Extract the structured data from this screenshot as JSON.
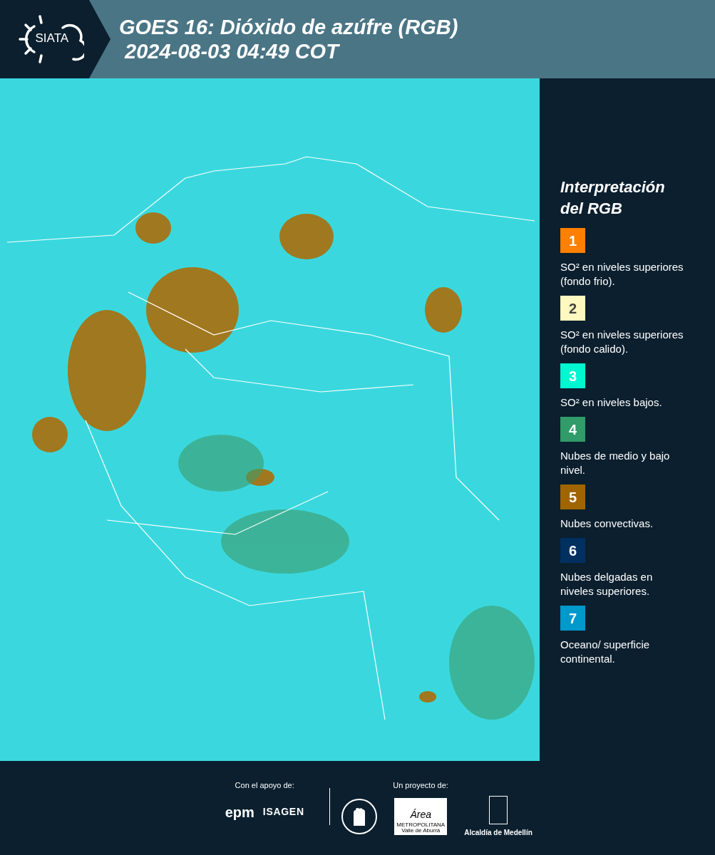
{
  "header": {
    "logo": "SIATA",
    "title": "GOES 16: Dióxido de azúfre (RGB)",
    "subtitle": "2024-08-03 04:49 COT"
  },
  "legend": {
    "title": "Interpretación del RGB",
    "items": [
      {
        "number": "1",
        "color": "#ff7f00",
        "label": "SO² en niveles superiores (fondo frio)."
      },
      {
        "number": "2",
        "color": "#fff9c0",
        "label": "SO² en niveles superiores (fondo calido)."
      },
      {
        "number": "3",
        "color": "#00f7d0",
        "label": "SO² en niveles bajos."
      },
      {
        "number": "4",
        "color": "#319b69",
        "label": "Nubes de medio y bajo nivel."
      },
      {
        "number": "5",
        "color": "#a06500",
        "label": "Nubes convectivas."
      },
      {
        "number": "6",
        "color": "#003060",
        "label": "Nubes delgadas en niveles superiores."
      },
      {
        "number": "7",
        "color": "#0099cc",
        "label": "Oceano/ superficie continental."
      }
    ]
  },
  "footer": {
    "support_label": "Con el apoyo de:",
    "support_logos": [
      "epm",
      "ISAGEN"
    ],
    "project_label": "Un proyecto de:",
    "area_logo": {
      "name": "Área",
      "line1": "METROPOLITANA",
      "line2": "Valle de Aburrá"
    },
    "city_logo": "Alcaldía de Medellín"
  }
}
